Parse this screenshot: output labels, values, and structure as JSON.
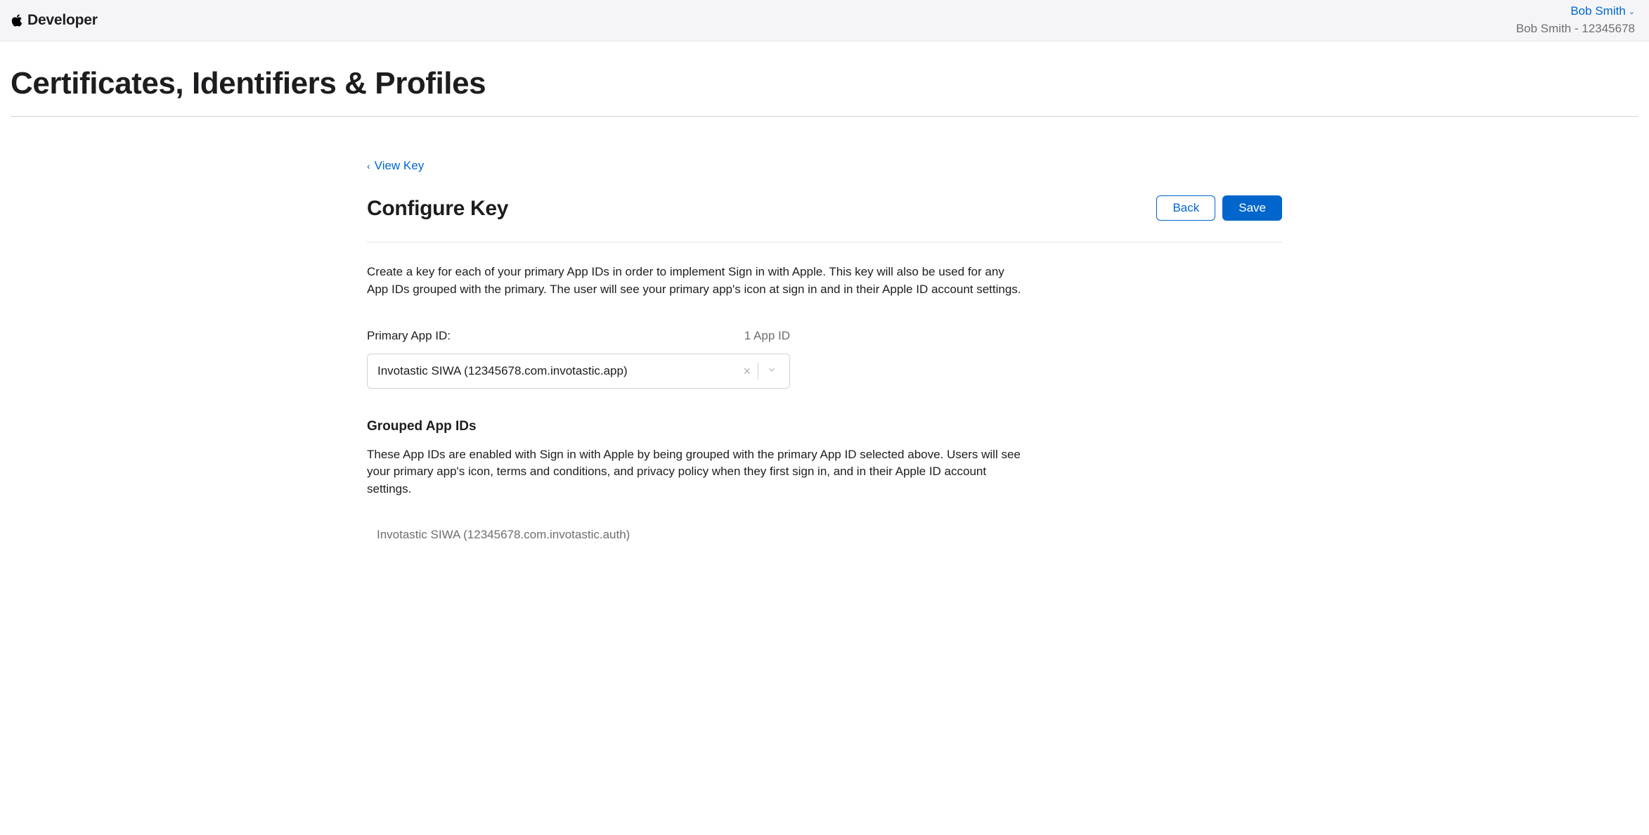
{
  "header": {
    "brand": "Developer",
    "account_name": "Bob Smith",
    "team_line": "Bob Smith - 12345678"
  },
  "page": {
    "title": "Certificates, Identifiers & Profiles",
    "back_link": "View Key",
    "section_title": "Configure Key",
    "back_button": "Back",
    "save_button": "Save",
    "description": "Create a key for each of your primary App IDs in order to implement Sign in with Apple. This key will also be used for any App IDs grouped with the primary. The user will see your primary app's icon at sign in and in their Apple ID account settings.",
    "primary_label": "Primary App ID:",
    "primary_count": "1 App ID",
    "primary_value": "Invotastic SIWA (12345678.com.invotastic.app)",
    "grouped_heading": "Grouped App IDs",
    "grouped_description": "These App IDs are enabled with Sign in with Apple by being grouped with the primary App ID selected above. Users will see your primary app's icon, terms and conditions, and privacy policy when they first sign in, and in their Apple ID account settings.",
    "grouped_items": [
      "Invotastic SIWA (12345678.com.invotastic.auth)"
    ]
  }
}
